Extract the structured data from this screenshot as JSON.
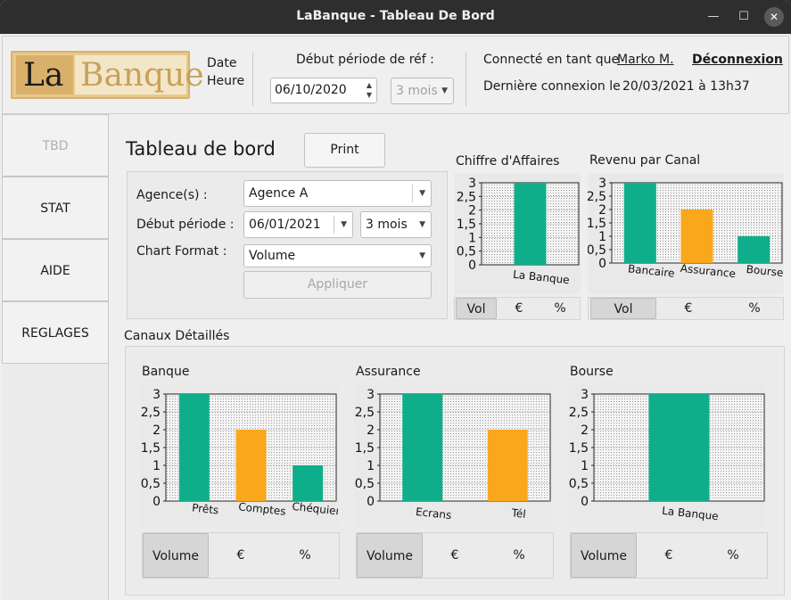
{
  "window": {
    "title": "LaBanque - Tableau De Bord",
    "minimize": "—",
    "maximize": "☐",
    "close": "✕"
  },
  "logo": {
    "part1": "La",
    "part2": "Banque"
  },
  "header": {
    "date_label": "Date",
    "heure_label": "Heure",
    "period_label": "Début période de réf :",
    "date_value": "06/10/2020",
    "period_duration": "3 mois",
    "connected_label": "Connecté en tant que",
    "user_name": "Marko M.",
    "logout": "Déconnexion",
    "last_login_label": "Dernière connexion le",
    "last_login_value": "20/03/2021 à 13h37"
  },
  "sidebar": {
    "items": [
      {
        "label": "TBD"
      },
      {
        "label": "STAT"
      },
      {
        "label": "AIDE"
      },
      {
        "label": "REGLAGES"
      }
    ]
  },
  "main": {
    "title": "Tableau de bord",
    "print": "Print",
    "agence_label": "Agence(s) :",
    "agence_value": "Agence A",
    "debut_label": "Début période :",
    "debut_value": "06/01/2021",
    "duree_value": "3 mois",
    "format_label": "Chart Format :",
    "format_value": "Volume",
    "apply": "Appliquer",
    "canaux_title": "Canaux Détaillés"
  },
  "toggles": {
    "short": {
      "vol": "Vol",
      "eur": "€",
      "pct": "%"
    },
    "long": {
      "vol": "Volume",
      "eur": "€",
      "pct": "%"
    }
  },
  "colors": {
    "primary": "#0fae8b",
    "secondary": "#f9a81b"
  },
  "chart_data": [
    {
      "id": "ca",
      "type": "bar",
      "title": "Chiffre d'Affaires",
      "categories": [
        "La Banque"
      ],
      "values": [
        3
      ],
      "ylim": [
        0,
        3
      ],
      "yticks": [
        "0",
        "0,5",
        "1",
        "1,5",
        "2",
        "2,5",
        "3"
      ],
      "grid": true
    },
    {
      "id": "canal",
      "type": "bar",
      "title": "Revenu par Canal",
      "categories": [
        "Bancaire",
        "Assurance",
        "Bourse"
      ],
      "values": [
        3,
        2,
        1
      ],
      "ylim": [
        0,
        3
      ],
      "yticks": [
        "0",
        "0,5",
        "1",
        "1,5",
        "2",
        "2,5",
        "3"
      ],
      "grid": true
    },
    {
      "id": "banque",
      "type": "bar",
      "title": "Banque",
      "categories": [
        "Prêts",
        "Comptes",
        "Chéquiers"
      ],
      "values": [
        3,
        2,
        1
      ],
      "ylim": [
        0,
        3
      ],
      "yticks": [
        "0",
        "0,5",
        "1",
        "1,5",
        "2",
        "2,5",
        "3"
      ],
      "grid": true
    },
    {
      "id": "assurance",
      "type": "bar",
      "title": "Assurance",
      "categories": [
        "Ecrans",
        "Tél"
      ],
      "values": [
        3,
        2
      ],
      "ylim": [
        0,
        3
      ],
      "yticks": [
        "0",
        "0,5",
        "1",
        "1,5",
        "2",
        "2,5",
        "3"
      ],
      "grid": true
    },
    {
      "id": "bourse",
      "type": "bar",
      "title": "Bourse",
      "categories": [
        "La Banque"
      ],
      "values": [
        3
      ],
      "ylim": [
        0,
        3
      ],
      "yticks": [
        "0",
        "0,5",
        "1",
        "1,5",
        "2",
        "2,5",
        "3"
      ],
      "grid": true
    }
  ]
}
